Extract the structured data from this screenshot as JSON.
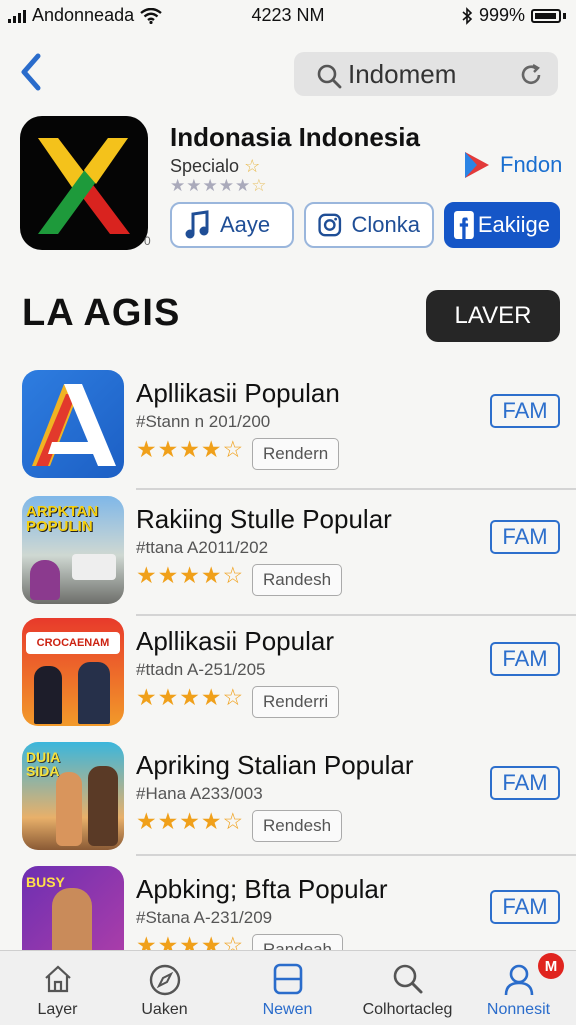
{
  "status": {
    "carrier": "Andonneada",
    "time": "4223 NM",
    "battery": "999%"
  },
  "search": {
    "text": "Indomem"
  },
  "app": {
    "name": "Indonasia Indonesia",
    "subtitle": "Specialo",
    "version": "0",
    "brand_label": "Fndon",
    "buttons": [
      {
        "label": "Aaye",
        "icon": "music-note-icon"
      },
      {
        "label": "Clonka",
        "icon": "instagram-icon"
      },
      {
        "label": "Eakiige",
        "icon": "facebook-icon"
      }
    ]
  },
  "section": {
    "title": "LA AGIS",
    "button": "LAVER"
  },
  "list": [
    {
      "title": "Apllikasii Populan",
      "meta": "#Stann n 201/200",
      "tag": "Rendern",
      "action": "FAM",
      "rating": 4.5
    },
    {
      "title": "Rakiing Stulle Popular",
      "meta": "#ttana A2011/202",
      "tag": "Randesh",
      "action": "FAM",
      "rating": 4.5,
      "thumb_text": "ARPKTAN POPULIN"
    },
    {
      "title": "Apllikasii Popular",
      "meta": "#ttadn A-251/205",
      "tag": "Renderri",
      "action": "FAM",
      "rating": 4.5,
      "thumb_text": "CROCAENAM"
    },
    {
      "title": "Apriking Stalian Popular",
      "meta": "#Hana A233/003",
      "tag": "Rendesh",
      "action": "FAM",
      "rating": 4.5,
      "thumb_text": "DUIA SIDA"
    },
    {
      "title": "Apbking; Bfta Popular",
      "meta": "#Stana A-231/209",
      "tag": "Randeah",
      "action": "FAM",
      "rating": 4.5,
      "thumb_text": "BUSY"
    }
  ],
  "tabs": [
    {
      "label": "Layer",
      "icon": "house-icon"
    },
    {
      "label": "Uaken",
      "icon": "explore-icon"
    },
    {
      "label": "Newen",
      "icon": "layers-icon"
    },
    {
      "label": "Colhortacleg",
      "icon": "search-icon"
    },
    {
      "label": "Nonnesit",
      "icon": "person-icon",
      "badge": "M"
    }
  ],
  "colors": {
    "accent": "#1556c7",
    "star": "#f0a01a",
    "badge": "#e0241f"
  }
}
